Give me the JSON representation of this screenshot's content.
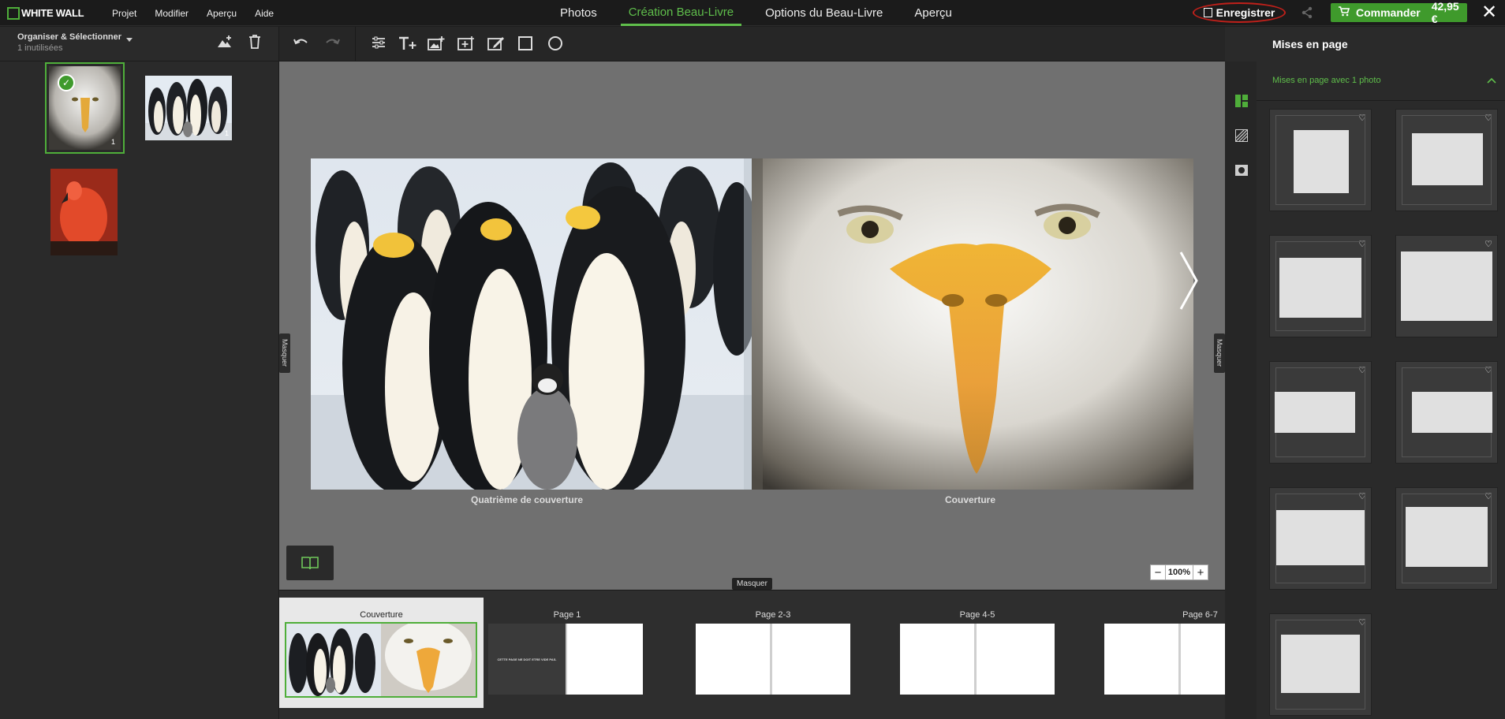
{
  "app": {
    "logo": "WHITE WALL",
    "menu": [
      "Projet",
      "Modifier",
      "Aperçu",
      "Aide"
    ]
  },
  "tabs": [
    {
      "label": "Photos",
      "active": false
    },
    {
      "label": "Création Beau-Livre",
      "active": true
    },
    {
      "label": "Options du Beau-Livre",
      "active": false
    },
    {
      "label": "Aperçu",
      "active": false
    }
  ],
  "header": {
    "save_label": "Enregistrer",
    "order_label": "Commander",
    "order_price": "42,95 €"
  },
  "left_panel": {
    "title": "Organiser & Sélectionner",
    "subtitle": "1 inutilisées",
    "photos": [
      {
        "subject": "eagle",
        "count": "1",
        "selected": true
      },
      {
        "subject": "penguins",
        "count": "1",
        "selected": false
      },
      {
        "subject": "flamingo",
        "count": "",
        "selected": false
      }
    ]
  },
  "toolbar": {
    "icons": [
      "undo-icon",
      "redo-icon",
      "adjust-icon",
      "text-add-icon",
      "image-add-icon",
      "frame-add-icon",
      "edit-icon",
      "rectangle-icon",
      "circle-icon"
    ]
  },
  "canvas": {
    "left_page_label": "Quatrième de couverture",
    "right_page_label": "Couverture",
    "hide_label": "Masquer",
    "zoom_value": "100%",
    "zoom_minus": "−",
    "zoom_plus": "+",
    "bottom_hide_label": "Masquer"
  },
  "filmstrip": {
    "items": [
      {
        "label": "Couverture",
        "active": true
      },
      {
        "label": "Page 1",
        "active": false,
        "text": "CETTE PAGE NE DOIT ETRE VIDE PAS."
      },
      {
        "label": "Page 2-3",
        "active": false
      },
      {
        "label": "Page 4-5",
        "active": false
      },
      {
        "label": "Page 6-7",
        "active": false
      }
    ]
  },
  "right_panel": {
    "title": "Mises en page",
    "section_label": "Mises en page avec 1 photo",
    "layout_count": 9
  },
  "colors": {
    "accent_green": "#5fbe4b",
    "order_green": "#3f9a2c",
    "save_highlight": "#c0201a"
  }
}
